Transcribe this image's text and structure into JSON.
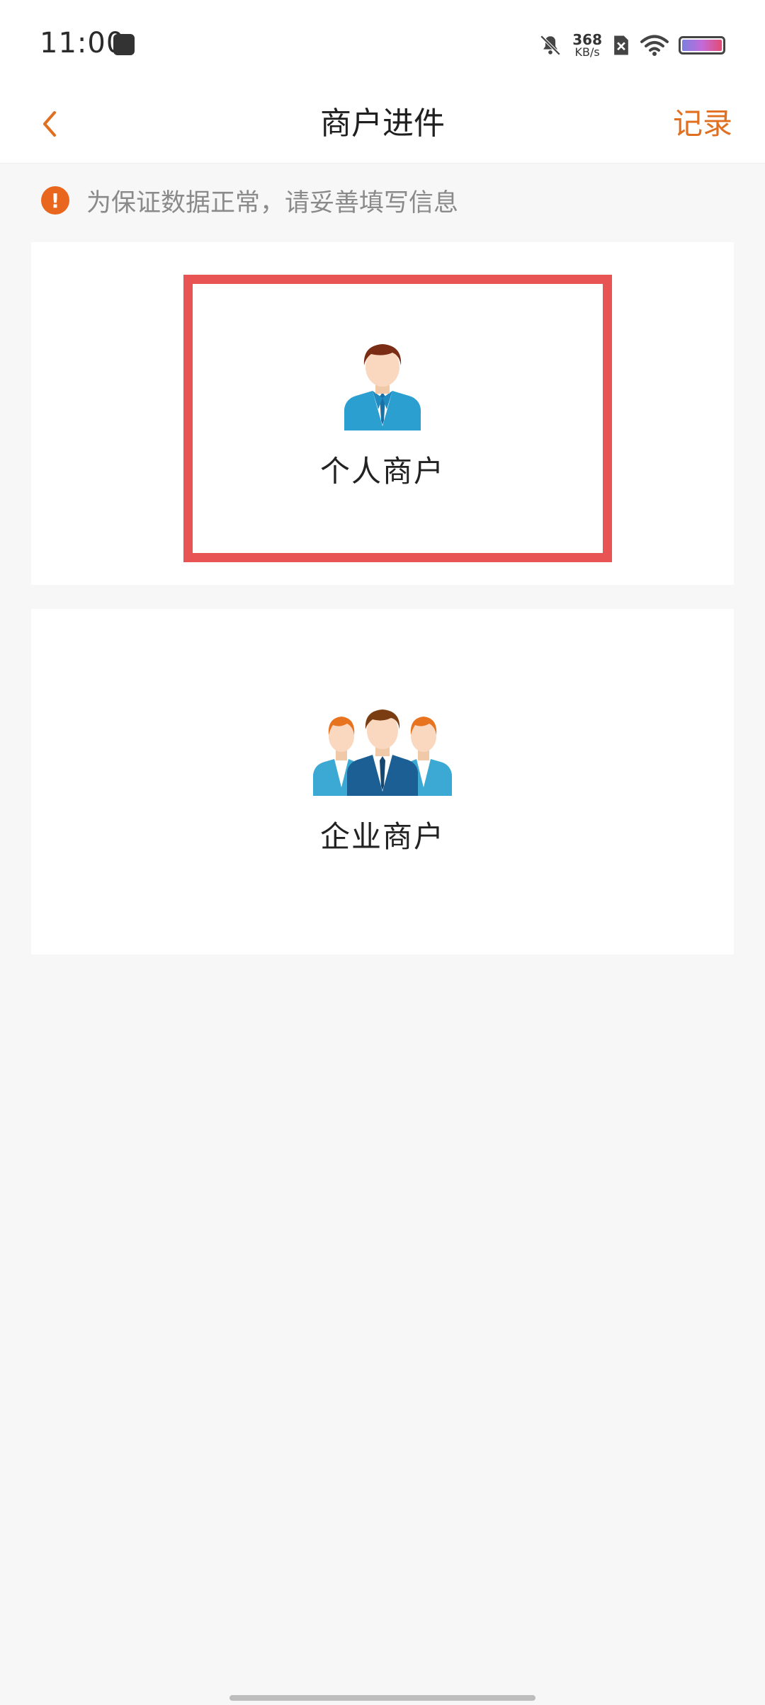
{
  "status_bar": {
    "time": "11:00",
    "net_speed_value": "368",
    "net_speed_unit": "KB/s",
    "icons": [
      "notification-app-icon",
      "bell-muted-icon",
      "sim-x-icon",
      "wifi-icon",
      "battery-icon"
    ]
  },
  "header": {
    "title": "商户进件",
    "records_label": "记录",
    "back_icon": "chevron-left-icon",
    "accent_color": "#e07020"
  },
  "notice": {
    "icon": "!",
    "text": "为保证数据正常，请妥善填写信息",
    "icon_color": "#e8661e"
  },
  "options": [
    {
      "label": "个人商户",
      "icon": "single-person-icon",
      "selected": true
    },
    {
      "label": "企业商户",
      "icon": "group-people-icon",
      "selected": false
    }
  ],
  "highlight_color": "#e85454"
}
